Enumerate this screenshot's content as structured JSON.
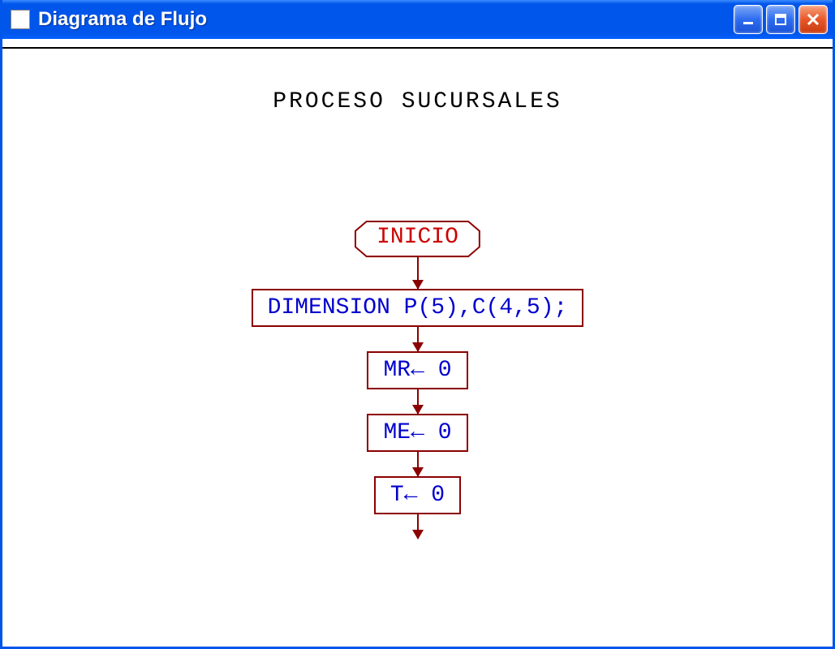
{
  "window": {
    "title": "Diagrama de Flujo"
  },
  "diagram": {
    "heading": "PROCESO SUCURSALES",
    "nodes": {
      "start": "INICIO",
      "dimension": "DIMENSION P(5),C(4,5);",
      "mr": "MR← 0",
      "me": "ME← 0",
      "t": "T← 0"
    }
  }
}
